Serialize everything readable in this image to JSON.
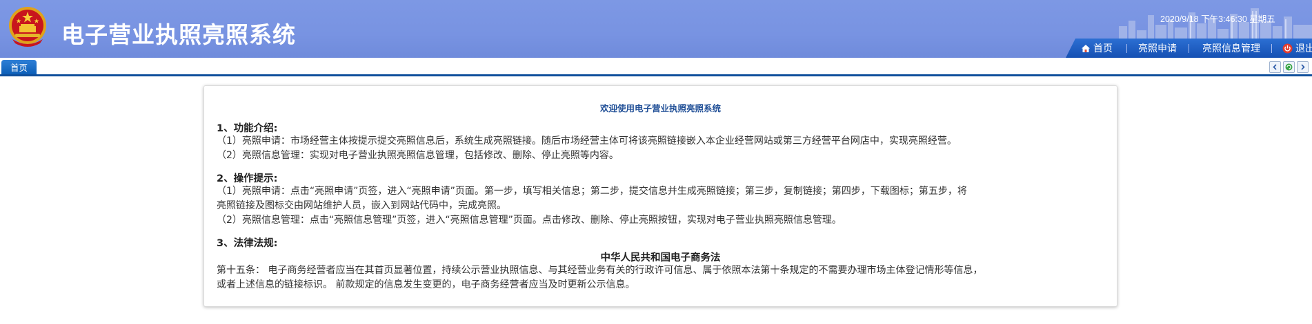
{
  "header": {
    "title": "电子营业执照亮照系统",
    "datetime": "2020/9/18 下午3:46:30 星期五",
    "nav": [
      {
        "label": "首页",
        "icon": "home-icon"
      },
      {
        "label": "亮照申请",
        "icon": ""
      },
      {
        "label": "亮照信息管理",
        "icon": ""
      },
      {
        "label": "退出",
        "icon": "power-icon"
      }
    ],
    "colors": {
      "header_bg": "#7d98e4",
      "nav_bg": "#1f5fc4",
      "tab_accent": "#0e4e9b"
    }
  },
  "tabs": {
    "active": "首页",
    "controls": [
      "chevron-left-icon",
      "refresh-icon",
      "chevron-right-icon"
    ]
  },
  "content": {
    "welcome": "欢迎使用电子营业执照亮照系统",
    "section1": {
      "heading": "1、功能介绍:",
      "lines": [
        "（1）亮照申请：市场经营主体按提示提交亮照信息后，系统生成亮照链接。随后市场经营主体可将该亮照链接嵌入本企业经营网站或第三方经营平台网店中，实现亮照经营。",
        "（2）亮照信息管理：实现对电子营业执照亮照信息管理，包括修改、删除、停止亮照等内容。"
      ]
    },
    "section2": {
      "heading": "2、操作提示:",
      "lines": [
        "（1）亮照申请：点击“亮照申请”页签，进入“亮照申请”页面。第一步，填写相关信息；第二步，提交信息并生成亮照链接；第三步，复制链接；第四步，下载图标；第五步，将",
        "亮照链接及图标交由网站维护人员，嵌入到网站代码中，完成亮照。",
        "（2）亮照信息管理：点击“亮照信息管理”页签，进入“亮照信息管理”页面。点击修改、删除、停止亮照按钮，实现对电子营业执照亮照信息管理。"
      ]
    },
    "section3": {
      "heading": "3、法律法规:",
      "law_title": "中华人民共和国电子商务法",
      "lines": [
        "第十五条： 电子商务经营者应当在其首页显著位置，持续公示营业执照信息、与其经营业务有关的行政许可信息、属于依照本法第十条规定的不需要办理市场主体登记情形等信息，",
        "或者上述信息的链接标识。 前款规定的信息发生变更的，电子商务经营者应当及时更新公示信息。"
      ]
    }
  }
}
